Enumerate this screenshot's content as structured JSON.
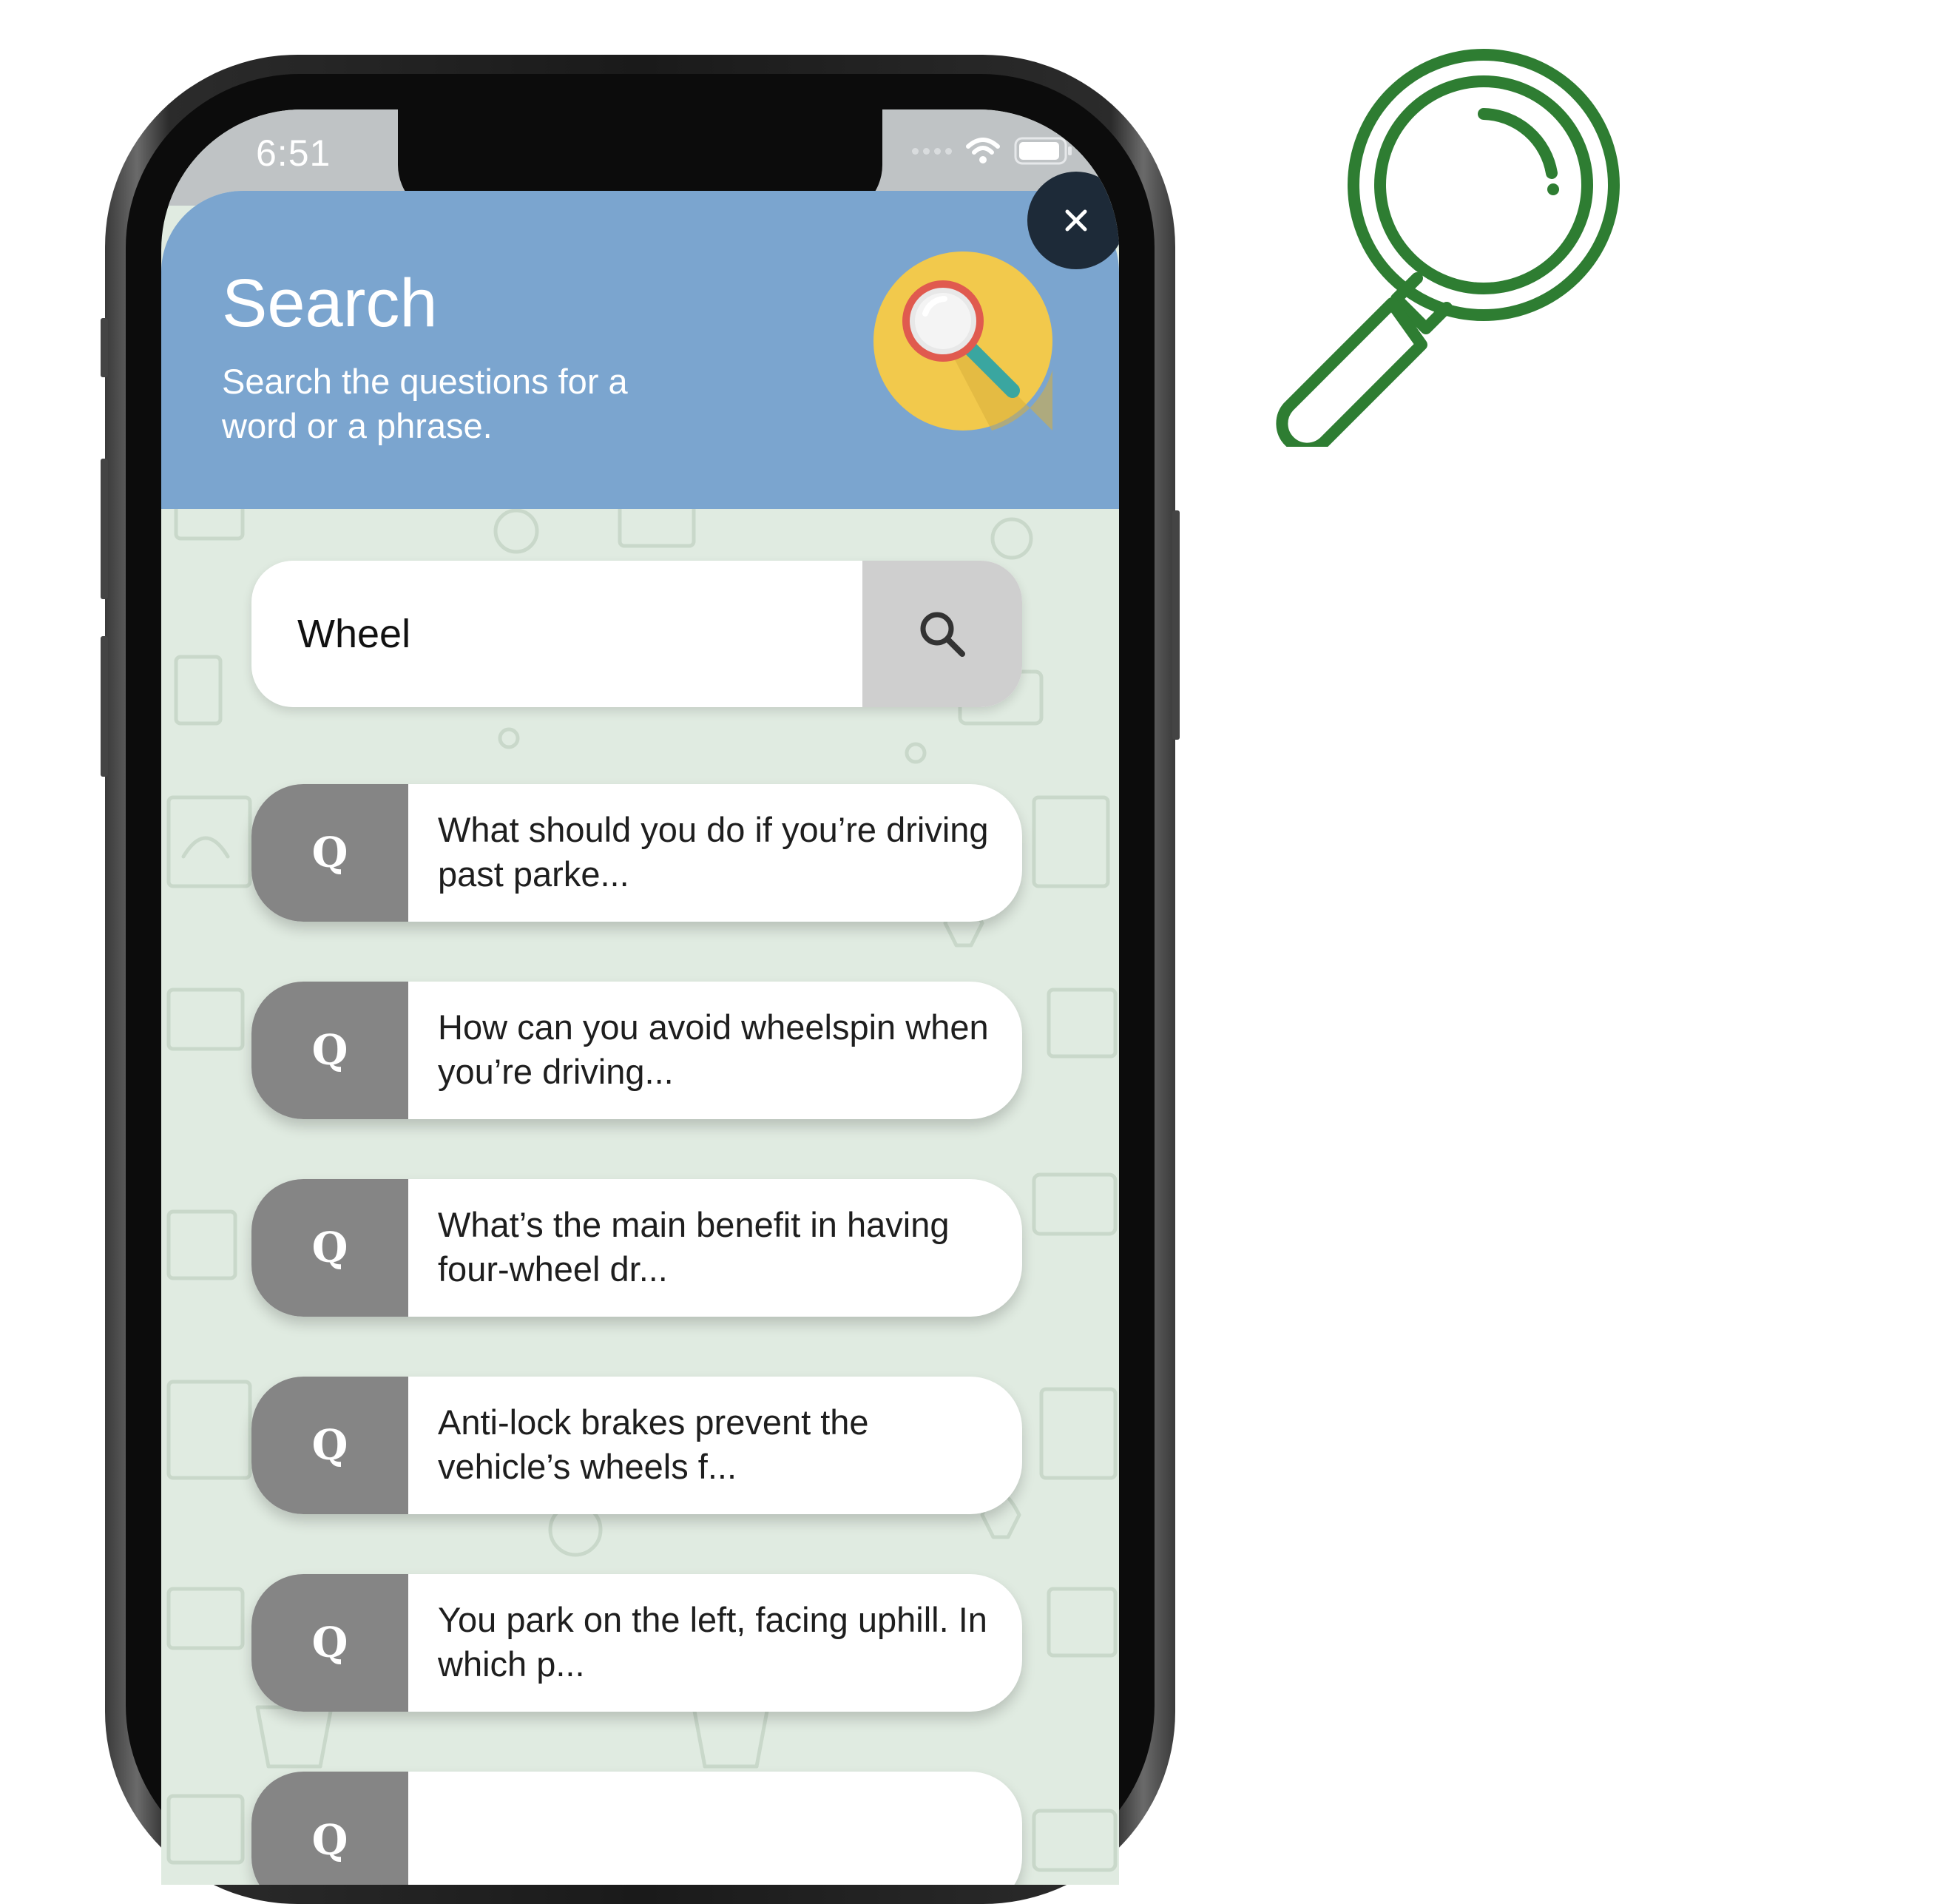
{
  "status_bar": {
    "time": "6:51"
  },
  "header": {
    "title": "Search",
    "subtitle": "Search the questions for a word or a phrase."
  },
  "search": {
    "value": "Wheel",
    "placeholder": ""
  },
  "results": [
    {
      "badge": "Q",
      "text": "What should you do if you’re driving past parke..."
    },
    {
      "badge": "Q",
      "text": "How can you avoid wheelspin when you’re driving..."
    },
    {
      "badge": "Q",
      "text": "What’s the main benefit in having four-wheel dr..."
    },
    {
      "badge": "Q",
      "text": "Anti-lock brakes prevent the vehicle’s wheels f..."
    },
    {
      "badge": "Q",
      "text": "You park on the left, facing uphill. In which p..."
    },
    {
      "badge": "Q",
      "text": ""
    }
  ],
  "icons": {
    "close": "close-icon",
    "search": "search-icon",
    "header_badge": "magnifier-badge-icon",
    "decorative": "magnifier-outline-icon"
  },
  "colors": {
    "header": "#7ba5cf",
    "background": "#e0ebe1",
    "q_badge": "#858585",
    "close_button": "#1d2a38",
    "badge_yellow": "#f2c94c",
    "decor_green": "#2e7d32"
  }
}
